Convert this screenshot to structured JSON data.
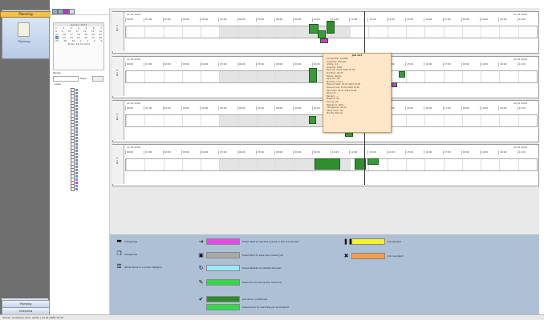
{
  "nav": {
    "tab_label": "Planning",
    "icon_label": "Planning",
    "bottom_btn_1": "Planning",
    "bottom_btn_2": "Overview"
  },
  "toolbar": {
    "icons": [
      "left-arrow-icon",
      "right-arrow-icon",
      "refresh-icon",
      "filter-icon"
    ]
  },
  "calendar": {
    "month": "January 2024",
    "weeks": [
      [
        "1",
        "2",
        "3",
        "4",
        "5",
        "6",
        "7"
      ],
      [
        "8",
        "9",
        "10",
        "11",
        "12",
        "13",
        "14"
      ],
      [
        "15",
        "16",
        "17",
        "18",
        "19",
        "20",
        "21"
      ],
      [
        "22",
        "23",
        "24",
        "25",
        "26",
        "27",
        "28"
      ],
      [
        "29",
        "30",
        "31",
        "1",
        "2",
        "3",
        "4"
      ]
    ],
    "footer": "Today: 22.01.2024",
    "range_label": "Range",
    "days_label": "Days"
  },
  "tree": {
    "root": "Lines"
  },
  "lanes": [
    {
      "name": "Lijn 1",
      "date": "22.01.2024",
      "right": "22.01.2024"
    },
    {
      "name": "Lijn 2",
      "date": "22.01.2024",
      "right": "22.01.2024"
    },
    {
      "name": "Lijn 3",
      "date": "22.01.2024",
      "right": "22.01.2024"
    },
    {
      "name": "Lijn 4",
      "date": "22.01.2024",
      "right": "22.01.2024"
    }
  ],
  "ticks": [
    "00:00",
    "01:00",
    "02:00",
    "03:00",
    "04:00",
    "05:00",
    "06:00",
    "07:00",
    "08:00",
    "09:00",
    "10:00",
    "11:00",
    "12:00",
    "13:00",
    "14:00",
    "15:00",
    "16:00",
    "17:00",
    "18:00",
    "19:00",
    "20:00",
    "21:00"
  ],
  "popup": {
    "title": "Job 123",
    "lines": [
      "Job Number: 123456",
      "Customer: Hillinga",
      "Article: 4-2",
      "Quantity: 1000",
      "Planned: 22.01.2024 10:00",
      "Duration: 02:30",
      "Status: Ready",
      "Operator: PP",
      "Machine: Line 2",
      "Planned start: 22.01.2024 10:00",
      "Planned end: 22.01.2024 12:30",
      "Real start: 22.01.2024 10:00",
      "Real end: ---",
      "Remark: ---",
      "Material: OK",
      "Tooling: OK",
      "Reference: 0001",
      "Changeover: 00:15",
      "Setup done: Yes",
      "Priority: Normal"
    ]
  },
  "legend": {
    "left": [
      {
        "icon": "folder-icon",
        "text": "Categories"
      },
      {
        "icon": "document-icon",
        "text": "Categories"
      },
      {
        "icon": "list-icon",
        "text": "Show items in current category"
      }
    ],
    "mid": [
      {
        "icon": "exit-icon",
        "label": "",
        "text": "Press Start to see the events in the current job",
        "color": "#e44be4"
      },
      {
        "icon": "save-icon",
        "label": "",
        "text": "Press Stop to save the current job",
        "color": "#a9a9a9"
      },
      {
        "icon": "refresh-icon",
        "label": "",
        "text": "Press Refresh to refresh the plan",
        "color": "#9fe7f5"
      },
      {
        "icon": "wrench-icon",
        "label": "",
        "text": "Press Tool to set up the machine",
        "color": "#35d64a"
      },
      {
        "icon": "check-icon",
        "label": "",
        "text": "Job done / confirmed",
        "color": "#2c8c2c"
      },
      {
        "icon": "",
        "label": "",
        "text": "Press Done to mark the job as finished",
        "color": "#33d84f"
      }
    ],
    "right": [
      {
        "icon": "pause-icon",
        "text": "Job paused",
        "color": "#f7f22f"
      },
      {
        "icon": "close-icon",
        "text": "Job cancelled",
        "color": "#f3a04b"
      }
    ]
  },
  "status": "Server: localhost | User: admin | 22.01.2024 10:15"
}
